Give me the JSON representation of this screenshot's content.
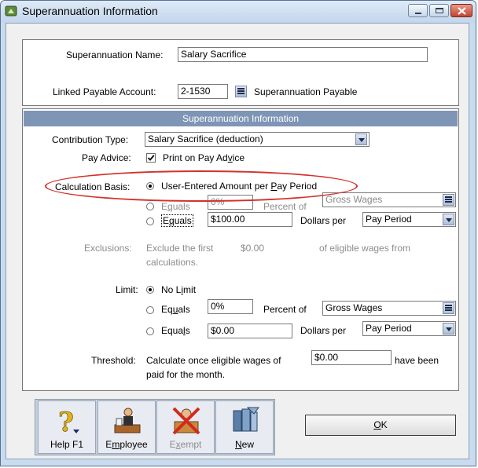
{
  "window": {
    "title": "Superannuation Information",
    "controls": {
      "minimize": "minimize-icon",
      "maximize": "maximize-icon",
      "close": "close-icon"
    }
  },
  "top": {
    "name_label": "Superannuation Name:",
    "name_value": "Salary Sacrifice",
    "linked_label": "Linked Payable Account:",
    "linked_account": "2-1530",
    "linked_name": "Superannuation Payable"
  },
  "section": {
    "header": "Superannuation Information"
  },
  "contribution": {
    "label": "Contribution Type:",
    "value": "Salary Sacrifice (deduction)"
  },
  "pay_advice": {
    "label": "Pay Advice:",
    "checked": true,
    "option_pre": "Print on Pay Ad",
    "option_u": "v",
    "option_post": "ice"
  },
  "calc": {
    "label": "Calculation Basis:",
    "opt1_pre": "User-Entered Amount per ",
    "opt1_u": "P",
    "opt1_post": "ay Period",
    "opt2_pre": "E",
    "opt2_u": "q",
    "opt2_post": "uals",
    "opt2_value": "0%",
    "opt2_mid": "Percent of",
    "opt2_select": "Gross Wages",
    "opt3_pre": "E",
    "opt3_u": "q",
    "opt3_post": "uals",
    "opt3_value": "$100.00",
    "opt3_mid": "Dollars per",
    "opt3_select": "Pay Period",
    "selected": 1
  },
  "exclusions": {
    "label": "Exclusions:",
    "text1": "Exclude the first",
    "value": "$0.00",
    "text2": "of eligible wages from",
    "text3": "calculations."
  },
  "limit": {
    "label": "Limit:",
    "opt1_pre": "No L",
    "opt1_u": "i",
    "opt1_post": "mit",
    "opt2_pre": "Eq",
    "opt2_u": "u",
    "opt2_post": "als",
    "opt2_value": "0%",
    "opt2_mid": "Percent of",
    "opt2_select": "Gross Wages",
    "opt3_pre": "Equa",
    "opt3_u": "l",
    "opt3_post": "s",
    "opt3_value": "$0.00",
    "opt3_mid": "Dollars per",
    "opt3_select": "Pay Period",
    "selected": 1
  },
  "threshold": {
    "label": "Threshold:",
    "text1": "Calculate once eligible wages of",
    "value": "$0.00",
    "text2": "have been",
    "text3": "paid for the month."
  },
  "toolbar": {
    "help": "Help F1",
    "employee_pre": "E",
    "employee_u": "m",
    "employee_post": "ployee",
    "exempt_pre": "E",
    "exempt_u": "x",
    "exempt_post": "empt",
    "new_u": "N",
    "new_post": "ew"
  },
  "ok": {
    "u": "O",
    "post": "K"
  },
  "colors": {
    "header_bg": "#7f95b6",
    "highlight_oval": "#d2322b"
  }
}
